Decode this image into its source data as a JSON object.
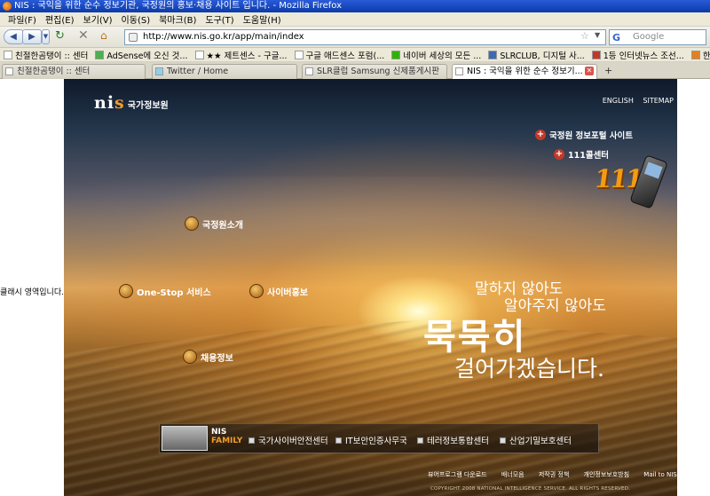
{
  "window": {
    "title": "NIS : 국익을 위한 순수 정보기관, 국정원의 홍보·채용 사이트 입니다. - Mozilla Firefox"
  },
  "menu": [
    "파일(F)",
    "편집(E)",
    "보기(V)",
    "이동(S)",
    "북마크(B)",
    "도구(T)",
    "도움말(H)"
  ],
  "nav": {
    "url": "http://www.nis.go.kr/app/main/index",
    "search_placeholder": "Google",
    "search_engine_glyph": "G"
  },
  "bookmarks": [
    "친절한곰탱이 :: 센터",
    "AdSense에 오신 것...",
    "★★ 제트센스 - 구글...",
    "구글 애드센스 포럼(...",
    "네이버 세상의 모든 ...",
    "SLRCLUB, 디지털 사...",
    "1등 인터넷뉴스 조선...",
    "한RSS - 내 RSS 리..."
  ],
  "bookmarks_more": "»",
  "tabs": [
    {
      "label": "친절한곰탱이 :: 센터",
      "active": false
    },
    {
      "label": "Twitter / Home",
      "active": false
    },
    {
      "label": "SLR클럽 Samsung 신제품게시판",
      "active": false
    },
    {
      "label": "NIS : 국익을 위한 순수 정보기...",
      "active": true
    }
  ],
  "new_tab_label": "+",
  "left_note": "클래시 영역입니다.",
  "site": {
    "logo_mark_prefix": "ni",
    "logo_mark_suffix": "s",
    "logo_name": "국가정보원",
    "top_links": [
      "ENGLISH",
      "SITEMAP"
    ],
    "portal_links": [
      "국정원 정보포털 사이트",
      "111콜센터"
    ],
    "call_number": "111",
    "menu_items": [
      "국정원소개",
      "One-Stop 서비스",
      "사이버홍보",
      "채용정보"
    ],
    "slogan": [
      "말하지 않아도",
      "알아주지 않아도",
      "묵묵히",
      "걸어가겠습니다."
    ],
    "family": {
      "label_top": "NIS",
      "label_bottom": "FAMILY",
      "links": [
        "국가사이버안전센터",
        "IT보안인증사무국",
        "테러정보통합센터",
        "산업기밀보호센터"
      ]
    },
    "footer_links": [
      "뷰어프로그램 다운로드",
      "배너모음",
      "저작권 정책",
      "개인정보보호방침",
      "Mail to NIS"
    ],
    "copyright": "COPYRIGHT 2008 NATIONAL INTELLIGENCE SERVICE. ALL RIGHTS RESERVED."
  }
}
